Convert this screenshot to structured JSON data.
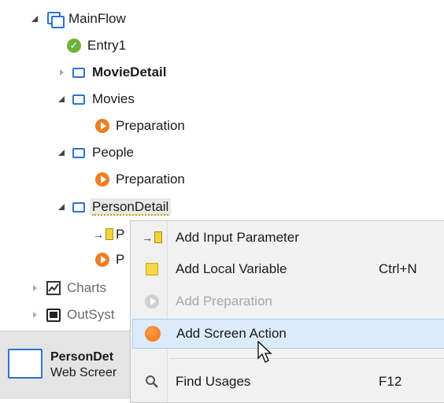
{
  "tree": {
    "items": [
      {
        "label": "MainFlow",
        "icon": "flow-icon"
      },
      {
        "label": "Entry1",
        "icon": "entry-icon"
      },
      {
        "label": "MovieDetail",
        "icon": "screen-icon"
      },
      {
        "label": "Movies",
        "icon": "screen-icon"
      },
      {
        "label": "Preparation",
        "icon": "preparation-icon"
      },
      {
        "label": "People",
        "icon": "screen-icon"
      },
      {
        "label": "Preparation",
        "icon": "preparation-icon"
      },
      {
        "label": "PersonDetail",
        "icon": "screen-icon"
      },
      {
        "label": "P",
        "icon": "input-parameter-icon"
      },
      {
        "label": "P",
        "icon": "preparation-icon"
      },
      {
        "label": "Charts",
        "icon": "chart-icon"
      },
      {
        "label": "OutSyst",
        "icon": "outsystems-icon"
      }
    ]
  },
  "info": {
    "name": "PersonDet",
    "type": "Web Screer"
  },
  "menu": {
    "items": [
      {
        "label": "Add Input Parameter",
        "shortcut": "",
        "icon": "input-parameter-icon"
      },
      {
        "label": "Add Local Variable",
        "shortcut": "Ctrl+N",
        "icon": "local-variable-icon"
      },
      {
        "label": "Add Preparation",
        "shortcut": "",
        "icon": "preparation-icon",
        "disabled": true
      },
      {
        "label": "Add Screen Action",
        "shortcut": "",
        "icon": "screen-action-icon",
        "highlighted": true
      },
      {
        "label": "Find Usages",
        "shortcut": "F12",
        "icon": "search-icon"
      }
    ]
  },
  "colors": {
    "accent": "#2a73d4",
    "preparation": "#f07d20",
    "entry": "#6db23a",
    "highlight": "#dcebfb"
  }
}
